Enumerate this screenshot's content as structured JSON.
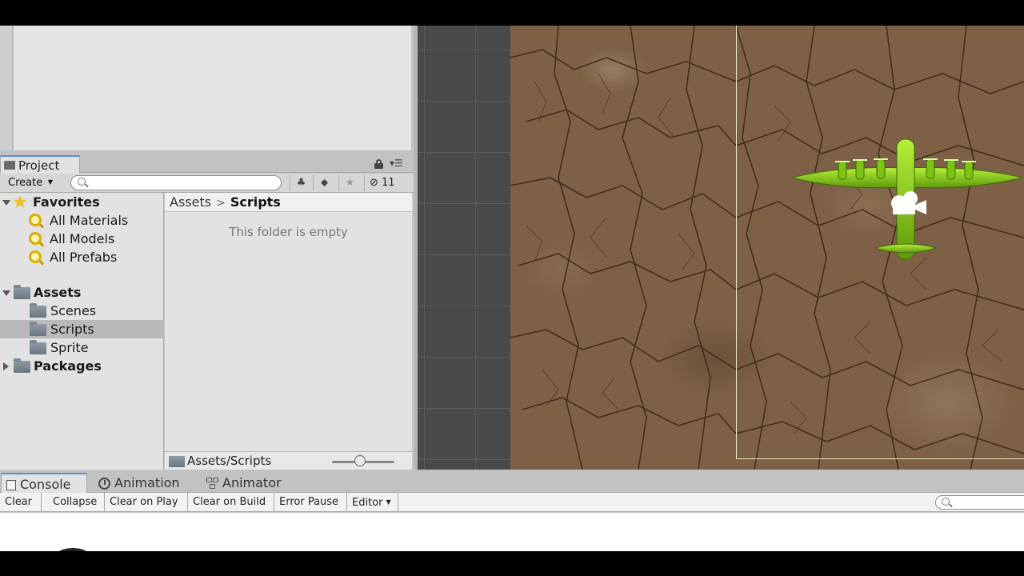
{
  "project": {
    "tab_label": "Project",
    "create_label": "Create",
    "search_placeholder": "",
    "hidden_count": "11",
    "tree": {
      "favorites_label": "Favorites",
      "favorites_items": [
        "All Materials",
        "All Models",
        "All Prefabs"
      ],
      "assets_label": "Assets",
      "assets_children": [
        "Scenes",
        "Scripts",
        "Sprite"
      ],
      "packages_label": "Packages",
      "selected": "Scripts"
    },
    "breadcrumb": [
      "Assets",
      "Scripts"
    ],
    "empty_message": "This folder is empty",
    "footer_path": "Assets/Scripts",
    "zoom_slider_value": 0.45
  },
  "console": {
    "tabs": [
      "Console",
      "Animation",
      "Animator"
    ],
    "active_tab": "Console",
    "toolbar": {
      "clear": "Clear",
      "collapse": "Collapse",
      "clear_on_play": "Clear on Play",
      "clear_on_build": "Clear on Build",
      "error_pause": "Error Pause",
      "editor": "Editor"
    },
    "search_placeholder": ""
  },
  "scene": {
    "object": "green bomber plane sprite",
    "accent_colors": {
      "plane": "#8fd11a",
      "ground": "#7d6046",
      "grid": "#494949"
    }
  }
}
